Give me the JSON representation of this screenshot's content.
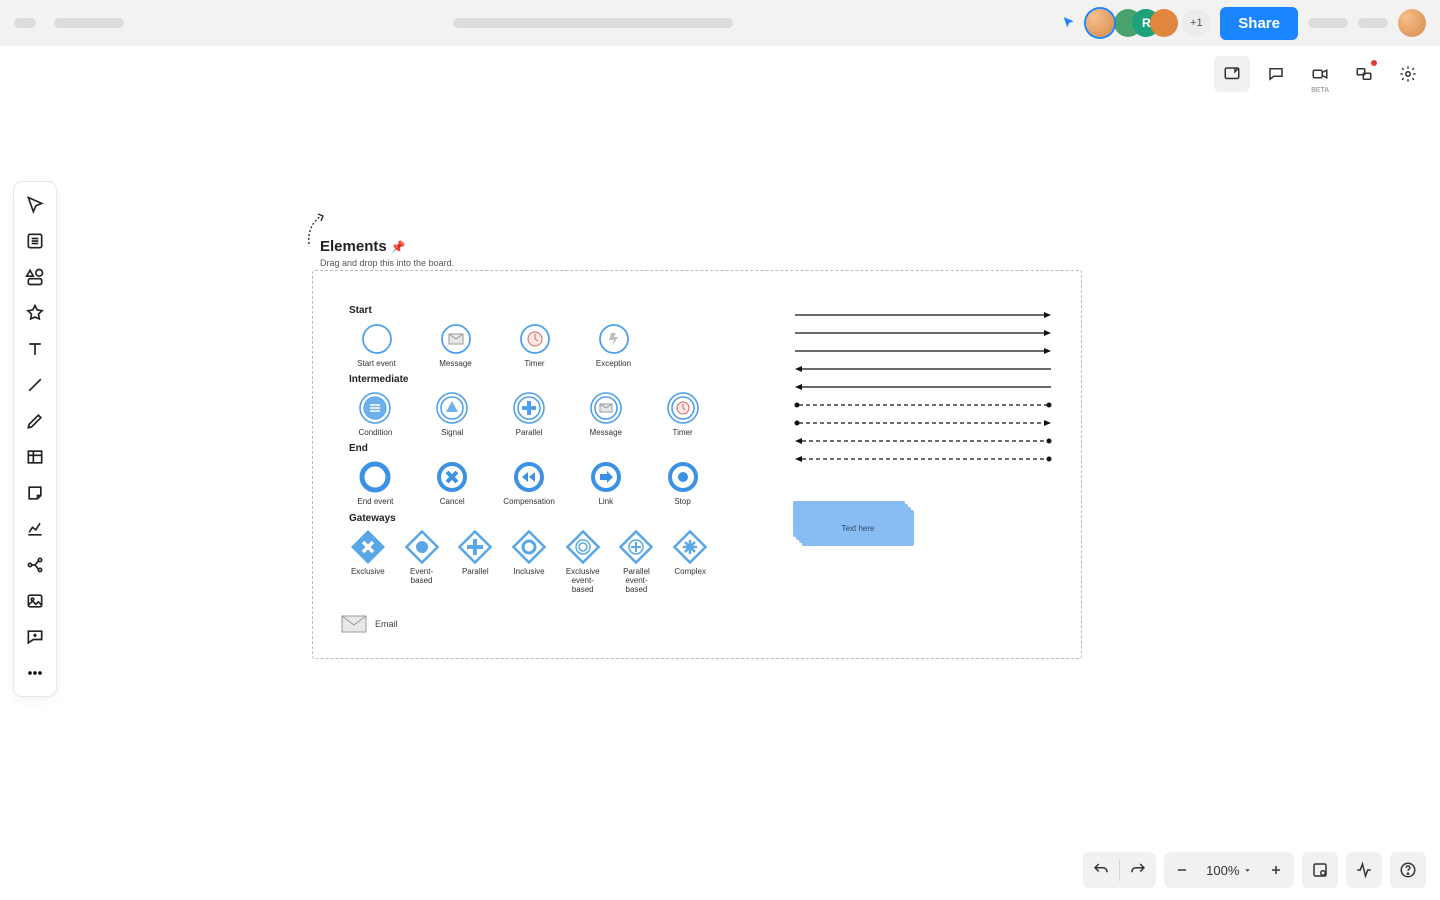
{
  "header": {
    "overflow_badge": "+1",
    "share_label": "Share"
  },
  "right_top": {
    "beta_label": "BETA"
  },
  "panel": {
    "title": "Elements",
    "subtitle": "Drag and drop this into the board."
  },
  "sections": {
    "start": {
      "title": "Start",
      "items": [
        "Start event",
        "Message",
        "Timer",
        "Exception"
      ]
    },
    "intermediate": {
      "title": "Intermediate",
      "items": [
        "Condition",
        "Signal",
        "Parallel",
        "Message",
        "Timer"
      ]
    },
    "end": {
      "title": "End",
      "items": [
        "End event",
        "Cancel",
        "Compensation",
        "Link",
        "Stop"
      ]
    },
    "gateways": {
      "title": "Gateways",
      "items": [
        "Exclusive",
        "Event-based",
        "Parallel",
        "Inclusive",
        "Exclusive event-based",
        "Parallel event-based",
        "Complex"
      ]
    }
  },
  "stack_card_label": "Text here",
  "email_label": "Email",
  "zoom": {
    "label": "100%"
  }
}
